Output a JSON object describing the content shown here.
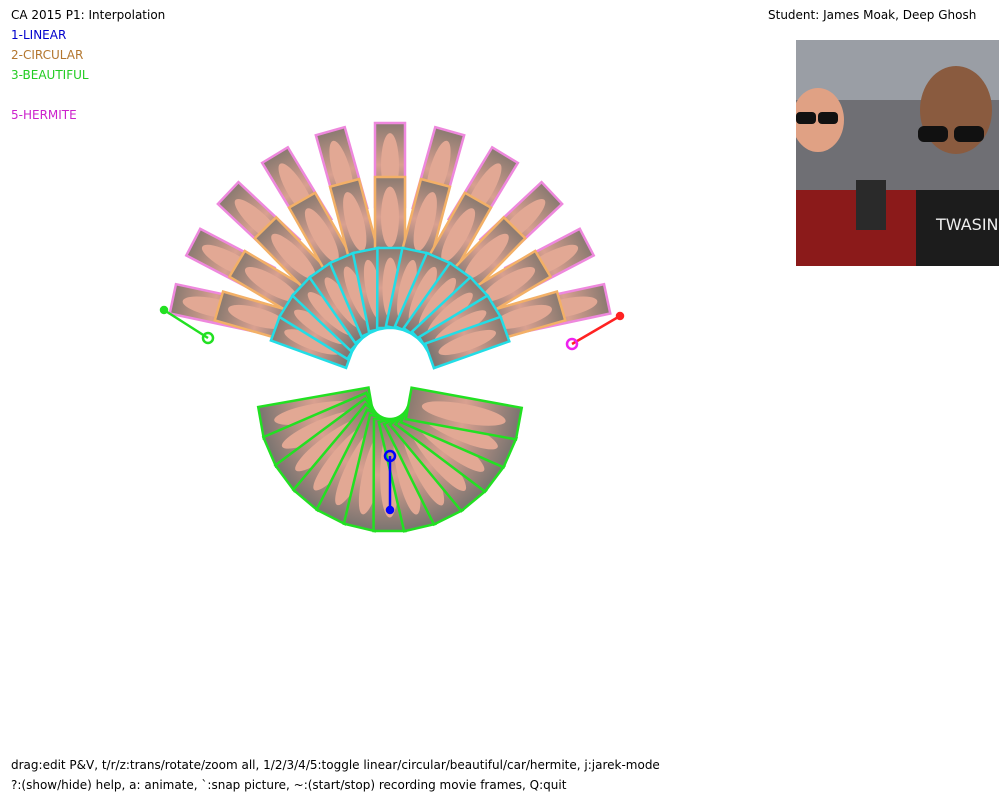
{
  "app": {
    "title": "CA 2015 P1: Interpolation",
    "student": "Student: James Moak, Deep Ghosh"
  },
  "modes": [
    {
      "label": "1-LINEAR",
      "color": "#0000cc"
    },
    {
      "label": "2-CIRCULAR",
      "color": "#b3762e"
    },
    {
      "label": "3-BEAUTIFUL",
      "color": "#22cc22"
    },
    {
      "label": "5-HERMITE",
      "color": "#cc22cc"
    }
  ],
  "help": {
    "line1": "drag:edit P&V, t/r/z:trans/rotate/zoom all, 1/2/3/4/5:toggle linear/circular/beautiful/car/hermite, j:jarek-mode",
    "line2": "?:(show/hide) help, a: animate, `:snap picture, ~:(start/stop) recording movie frames, Q:quit"
  },
  "colors": {
    "linear": "#0000ff",
    "circular": "#f3b067",
    "beautiful": "#22e022",
    "hermite": "#ee88dd",
    "cyan": "#22dde6",
    "start_arrow": "#22e022",
    "end_arrow": "#ff2222"
  },
  "icons": {
    "photo": "student-photo-image",
    "start_handle": "start-frame-handle-icon",
    "end_handle": "end-frame-handle-icon",
    "linear_handle": "linear-frame-handle-icon"
  }
}
